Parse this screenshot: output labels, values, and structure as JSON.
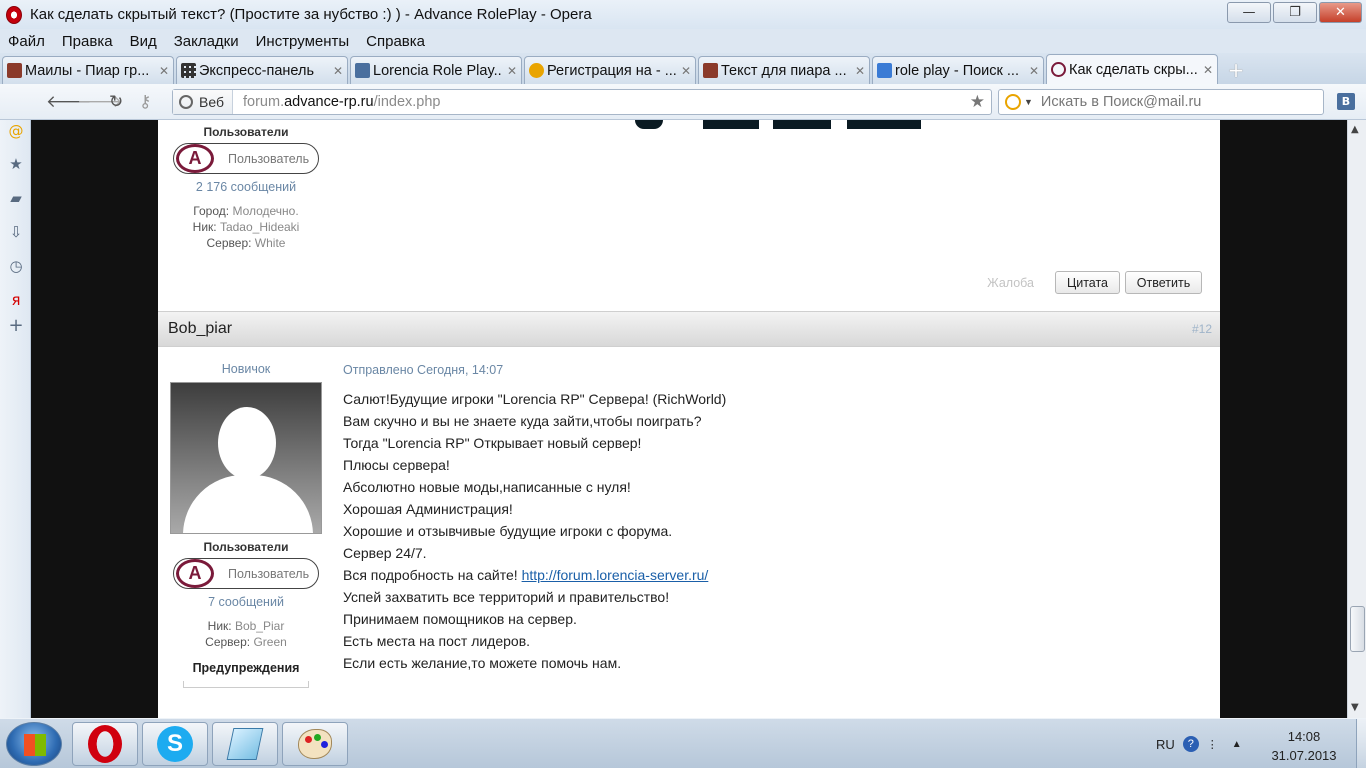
{
  "window": {
    "title": "Как сделать скрытый текст? (Простите за нубство :) ) - Advance RolePlay - Opera",
    "buttons": {
      "minimize": "—",
      "maximize": "❐",
      "close": "✕"
    }
  },
  "menu": [
    "Файл",
    "Правка",
    "Вид",
    "Закладки",
    "Инструменты",
    "Справка"
  ],
  "tabs": [
    {
      "label": "Маилы - Пиар гр...",
      "icon": "avatar-icon",
      "color": "#8b3a2a"
    },
    {
      "label": "Экспресс-панель",
      "icon": "grid-icon",
      "color": "#4a4a4a"
    },
    {
      "label": "Lorencia Role Play...",
      "icon": "vk-icon",
      "color": "#4a6f9e"
    },
    {
      "label": "Регистрация на - ...",
      "icon": "mail-ru-icon",
      "color": "#e9a400"
    },
    {
      "label": "Текст для пиара ...",
      "icon": "avatar-icon",
      "color": "#8b3a2a"
    },
    {
      "label": "role play - Поиск ...",
      "icon": "google-icon",
      "color": "#3a7bd5"
    },
    {
      "label": "Как сделать скры...",
      "icon": "advance-icon",
      "color": "#7a1a3a",
      "active": true
    }
  ],
  "address": {
    "security_label": "Веб",
    "url_prefix": "forum.",
    "url_domain": "advance-rp.ru",
    "url_path": "/index.php",
    "search_placeholder": "Искать в Поиск@mail.ru"
  },
  "post_prev": {
    "group_label": "Пользователи",
    "group_badge": "Пользователь",
    "message_count": "2 176 сообщений",
    "fields": [
      {
        "label": "Город:",
        "value": "Молодечно."
      },
      {
        "label": "Ник:",
        "value": "Tadao_Hideaki"
      },
      {
        "label": "Сервер:",
        "value": "White"
      }
    ],
    "report": "Жалоба",
    "quote": "Цитата",
    "reply": "Ответить"
  },
  "post": {
    "author": "Bob_piar",
    "number": "#12",
    "rank": "Новичок",
    "date": "Отправлено Сегодня, 14:07",
    "group_label": "Пользователи",
    "group_badge": "Пользователь",
    "message_count": "7 сообщений",
    "fields": [
      {
        "label": "Ник:",
        "value": "Bob_Piar"
      },
      {
        "label": "Сервер:",
        "value": "Green"
      }
    ],
    "warnings_label": "Предупреждения",
    "lines": [
      "Салют!Будущие игроки \"Lorencia RP\" Сервера! (RichWorld)",
      "Вам скучно и вы не знаете куда зайти,чтобы поиграть?",
      "Тогда \"Lorencia RP\" Открывает новый сервер!",
      "Плюсы сервера!",
      "Абсолютно новые моды,написанные с нуля!",
      "Хорошая Администрация!",
      "Хорошие и отзывчивые будущие игроки с форума.",
      "Сервер 24/7."
    ],
    "link_prefix": "Вся подробность на сайте! ",
    "link": "http://forum.lorencia-server.ru/",
    "lines_after": [
      "Успей захватить все территорий и правительство!",
      "Принимаем помощников на сервер.",
      "Есть места на пост лидеров.",
      "Если есть желание,то можете помочь нам."
    ]
  },
  "taskbar": {
    "language": "RU",
    "time": "14:08",
    "date": "31.07.2013"
  }
}
